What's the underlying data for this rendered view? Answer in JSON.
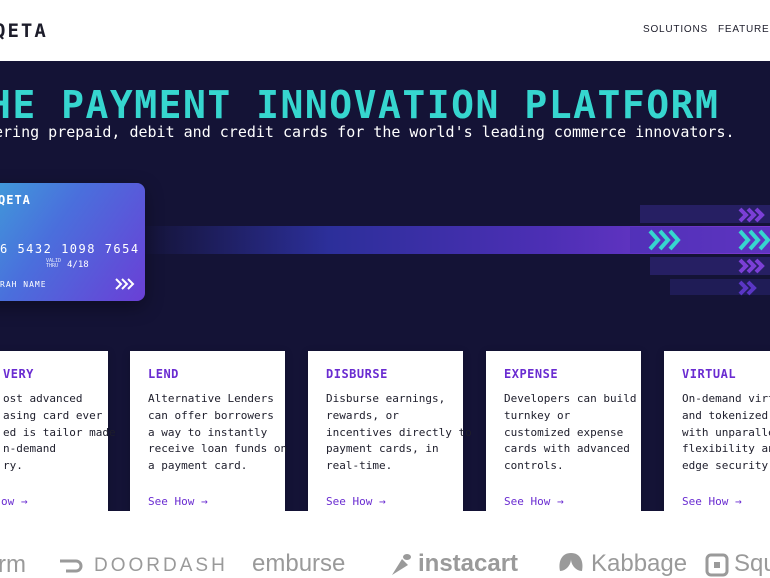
{
  "header": {
    "logo": "QETA",
    "nav": [
      "SOLUTIONS",
      "FEATURES"
    ]
  },
  "hero": {
    "title": "HE PAYMENT INNOVATION PLATFORM",
    "subtitle": "ering prepaid, debit and credit cards for the world's leading commerce innovators."
  },
  "card": {
    "brand": "QETA",
    "number": "6 5432 1098 7654",
    "valid_label_1": "VALID",
    "valid_label_2": "THRU",
    "expiry": "4/18",
    "name": "RAH NAME"
  },
  "features": [
    {
      "title": "VERY",
      "desc": "ost advanced\nasing card ever\ned is tailor made\nn-demand\nry.",
      "link": "ow →"
    },
    {
      "title": "LEND",
      "desc": "Alternative Lenders\ncan offer borrowers\na way to instantly\nreceive loan funds on\na payment card.",
      "link": "See How →"
    },
    {
      "title": "DISBURSE",
      "desc": "Disburse earnings,\nrewards, or\nincentives directly to\npayment cards, in\nreal-time.",
      "link": "See How →"
    },
    {
      "title": "EXPENSE",
      "desc": "Developers can build\nturnkey or\ncustomized expense\ncards with advanced\ncontrols.",
      "link": "See How →"
    },
    {
      "title": "VIRTUAL",
      "desc": "On-demand virtu\nand tokenized ca\nwith unparallele\nflexibility and lea\nedge security.",
      "link": "See How →"
    }
  ],
  "customers": [
    "rm",
    "DOORDASH",
    "emburse",
    "instacart",
    "Kabbage",
    "Squ"
  ],
  "colors": {
    "hero_bg": "#141336",
    "accent_teal": "#36d6cf",
    "accent_purple": "#6a2cd1"
  }
}
